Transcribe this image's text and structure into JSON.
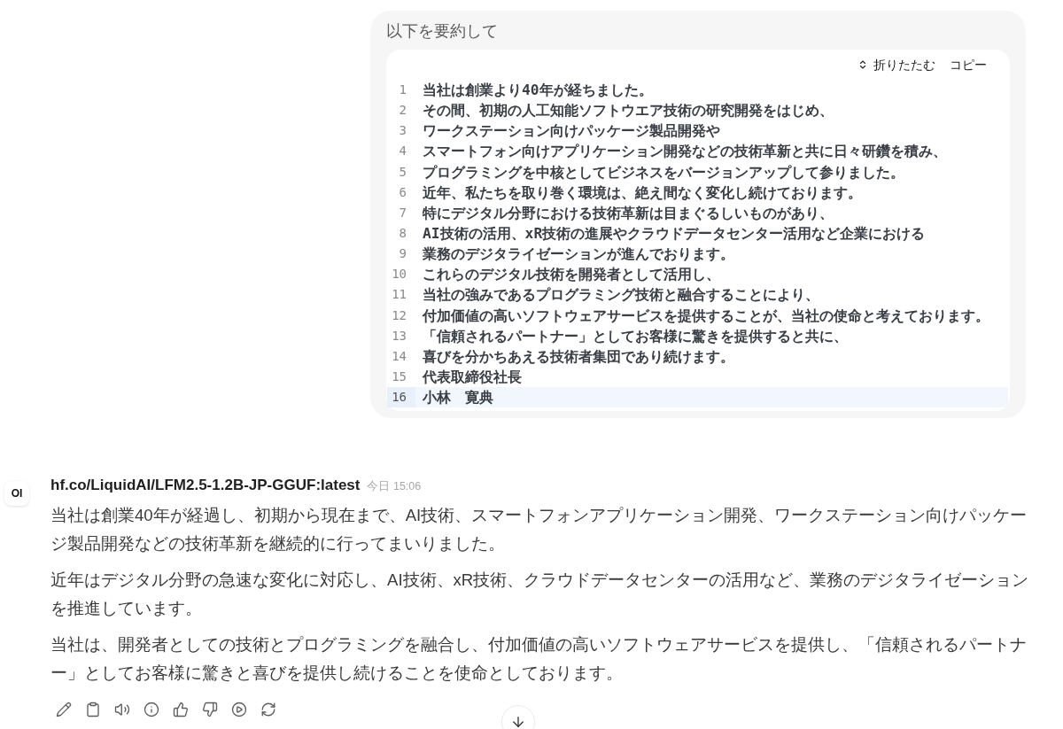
{
  "user_message": {
    "title": "以下を要約して",
    "code_block": {
      "actions": [
        {
          "kind": "collapse",
          "label": "折りたたむ"
        },
        {
          "kind": "copy",
          "label": "コピー"
        }
      ],
      "lines": [
        {
          "number": "1",
          "text": "当社は創業より40年が経ちました。",
          "active": false
        },
        {
          "number": "2",
          "text": "その間、初期の人工知能ソフトウエア技術の研究開発をはじめ、",
          "active": false
        },
        {
          "number": "3",
          "text": "ワークステーション向けパッケージ製品開発や",
          "active": false
        },
        {
          "number": "4",
          "text": "スマートフォン向けアプリケーション開発などの技術革新と共に日々研鑽を積み、",
          "active": false
        },
        {
          "number": "5",
          "text": "プログラミングを中核としてビジネスをバージョンアップして参りました。",
          "active": false
        },
        {
          "number": "6",
          "text": "近年、私たちを取り巻く環境は、絶え間なく変化し続けております。",
          "active": false
        },
        {
          "number": "7",
          "text": "特にデジタル分野における技術革新は目まぐるしいものがあり、",
          "active": false
        },
        {
          "number": "8",
          "text": "AI技術の活用、xR技術の進展やクラウドデータセンター活用など企業における",
          "active": false
        },
        {
          "number": "9",
          "text": "業務のデジタライゼーションが進んでおります。",
          "active": false
        },
        {
          "number": "10",
          "text": "これらのデジタル技術を開発者として活用し、",
          "active": false
        },
        {
          "number": "11",
          "text": "当社の強みであるプログラミング技術と融合することにより、",
          "active": false
        },
        {
          "number": "12",
          "text": "付加価値の高いソフトウェアサービスを提供することが、当社の使命と考えております。",
          "active": false
        },
        {
          "number": "13",
          "text": "「信頼されるパートナー」としてお客様に驚きを提供すると共に、",
          "active": false
        },
        {
          "number": "14",
          "text": "喜びを分かちあえる技術者集団であり続けます。",
          "active": false
        },
        {
          "number": "15",
          "text": "代表取締役社長",
          "active": false
        },
        {
          "number": "16",
          "text": "小林　寛典",
          "active": true
        }
      ]
    }
  },
  "assistant_message": {
    "avatar": "OI",
    "model": "hf.co/LiquidAI/LFM2.5-1.2B-JP-GGUF:latest",
    "timestamp": "今日 15:06",
    "paragraphs": [
      "当社は創業40年が経過し、初期から現在まで、AI技術、スマートフォンアプリケーション開発、ワークステーション向けパッケージ製品開発などの技術革新を継続的に行ってまいりました。",
      "近年はデジタル分野の急速な変化に対応し、AI技術、xR技術、クラウドデータセンターの活用など、業務のデジタライゼーションを推進しています。",
      "当社は、開発者としての技術とプログラミングを融合し、付加価値の高いソフトウェアサービスを提供し、「信頼されるパートナー」としてお客様に驚きと喜びを提供し続けることを使命としております。"
    ]
  }
}
